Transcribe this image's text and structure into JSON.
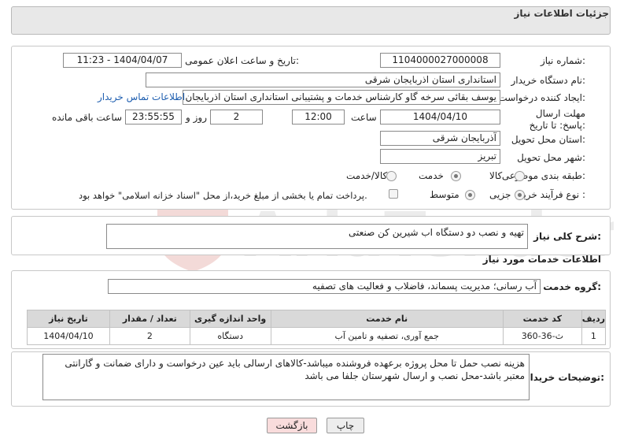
{
  "header": {
    "title": "جزئیات اطلاعات نیاز"
  },
  "form": {
    "need_number_label": "شماره نیاز:",
    "need_number": "1104000027000008",
    "announce_label": "تاریخ و ساعت اعلان عمومی:",
    "announce_value": "1404/04/07 - 11:23",
    "buyer_org_label": "نام دستگاه خریدار:",
    "buyer_org": "استانداری استان اذربایجان شرقی",
    "requester_label": "ایجاد کننده درخواست:",
    "requester": "یوسف بقائی سرخه گاو کارشناس خدمات و پشتیبانی استانداری استان اذربایجان شرقی",
    "contact_link": "اطلاعات تماس خریدار",
    "deadline_label": "مهلت ارسال پاسخ: تا تاریخ:",
    "deadline_date": "1404/04/10",
    "time_label": "ساعت",
    "deadline_time": "12:00",
    "days_value": "2",
    "days_label": "روز و",
    "remaining_time": "23:55:55",
    "remaining_label": "ساعت باقی مانده",
    "province_label": "استان محل تحویل:",
    "province": "آذربایجان شرقی",
    "city_label": "شهر محل تحویل:",
    "city": "تبریز",
    "category_label": "طبقه بندی موضوعی:",
    "category_options": [
      "کالا",
      "خدمت",
      "کالا/خدمت"
    ],
    "category_selected": "خدمت",
    "process_label": "نوع فرآیند خرید :",
    "process_options": [
      "جزیی",
      "متوسط"
    ],
    "process_selected": "جزیی",
    "payment_note": "پرداخت تمام یا بخشی از مبلغ خرید،از محل \"اسناد خزانه اسلامی\" خواهد بود."
  },
  "summary": {
    "label": "شرح کلی نیاز:",
    "value": "تهیه و نصب دو دستگاه اب شیرین کن صنعتی"
  },
  "services": {
    "section_title": "اطلاعات خدمات مورد نیاز",
    "group_label": "گروه خدمت:",
    "group_value": "آب رسانی؛ مدیریت پسماند، فاضلاب و فعالیت های تصفیه",
    "columns": [
      "ردیف",
      "کد خدمت",
      "نام خدمت",
      "واحد اندازه گیری",
      "تعداد / مقدار",
      "تاریخ نیاز"
    ],
    "rows": [
      {
        "row": "1",
        "code": "ث-36-360",
        "name": "جمع آوری، تصفیه و تامین آب",
        "unit": "دستگاه",
        "qty": "2",
        "date": "1404/04/10"
      }
    ]
  },
  "buyer_notes": {
    "label": "توضیحات خریدار:",
    "value": "هزینه نصب حمل تا محل پروژه برعهده فروشنده میباشد-کالاهای ارسالی باید عین درخواست و دارای ضمانت و گارانتی معتبر باشد-محل نصب و ارسال شهرستان جلفا می باشد"
  },
  "buttons": {
    "print": "چاپ",
    "back": "بازگشت"
  },
  "watermark": {
    "text": "AriaTender.neT"
  },
  "colors": {
    "link": "#1f5fb0",
    "back_button_bg": "#f9dcdc",
    "print_button_bg": "#ededed",
    "header_bg": "#e8e8e8"
  }
}
